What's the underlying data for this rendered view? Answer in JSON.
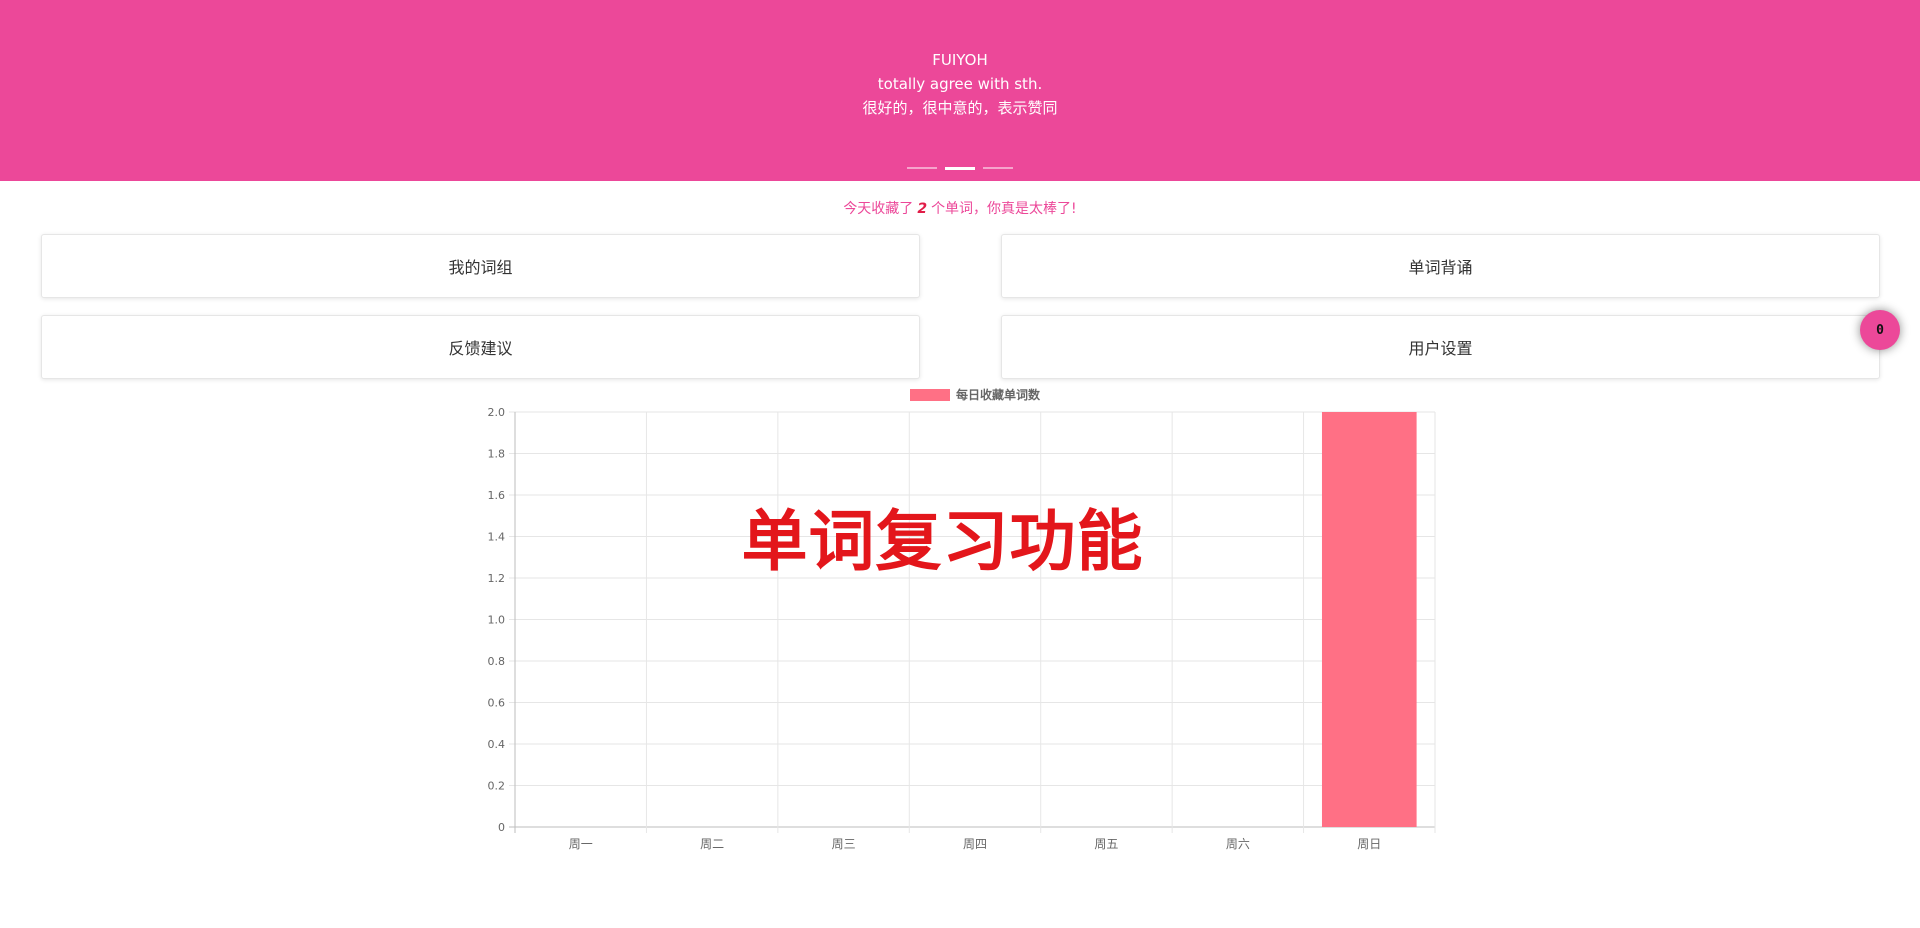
{
  "banner": {
    "line1": "FUIYOH",
    "line2": "totally agree with sth.",
    "line3": "很好的，很中意的，表示赞同",
    "background": "#ec4899",
    "indicators": [
      {
        "active": false
      },
      {
        "active": true
      },
      {
        "active": false
      }
    ]
  },
  "message": {
    "prefix": "今天收藏了",
    "count": "2",
    "suffix": "个单词，你真是太棒了!"
  },
  "cards": {
    "my_groups": "我的词组",
    "recite": "单词背诵",
    "feedback": "反馈建议",
    "settings": "用户设置"
  },
  "fab": {
    "count": "0"
  },
  "overlay_title": "单词复习功能",
  "chart_data": {
    "type": "bar",
    "categories": [
      "周一",
      "周二",
      "周三",
      "周四",
      "周五",
      "周六",
      "周日"
    ],
    "series": [
      {
        "name": "每日收藏单词数",
        "values": [
          0,
          0,
          0,
          0,
          0,
          0,
          2
        ],
        "color": "#ff7085"
      }
    ],
    "ylim": [
      0,
      2
    ],
    "yticks": [
      "0",
      "0.2",
      "0.4",
      "0.6",
      "0.8",
      "1.0",
      "1.2",
      "1.4",
      "1.6",
      "1.8",
      "2.0"
    ],
    "legend": "top-center",
    "grid": true
  }
}
